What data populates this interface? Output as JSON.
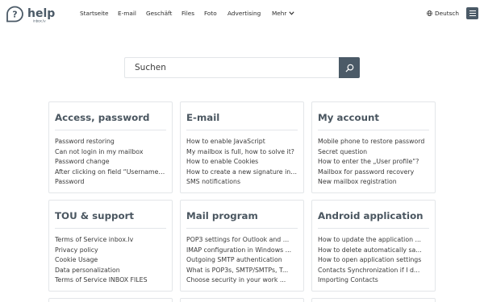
{
  "header": {
    "nav": [
      "Startseite",
      "E-mail",
      "Geschäft",
      "Files",
      "Foto",
      "Advertising",
      "Mehr"
    ],
    "language": "Deutsch"
  },
  "search": {
    "placeholder": "Suchen"
  },
  "cards": [
    {
      "title": "Access, password",
      "links": [
        "Password restoring",
        "Can not login in my mailbox",
        "Password change",
        "After clicking on field “Username” ...",
        "Password"
      ]
    },
    {
      "title": "E-mail",
      "links": [
        "How to enable JavaScript",
        "My mailbox is full, how to solve it?",
        "How to enable Cookies",
        "How to create a new signature in my ...",
        "SMS notifications"
      ]
    },
    {
      "title": "My account",
      "links": [
        "Mobile phone to restore password",
        "Secret question",
        "How to enter the „User profile”?",
        "Mailbox for password recovery",
        "New mailbox registration"
      ]
    },
    {
      "title": "TOU & support",
      "links": [
        "Terms of Service inbox.lv",
        "Privacy policy",
        "Cookie Usage",
        "Data personalization",
        "Terms of Service INBOX FILES"
      ]
    },
    {
      "title": "Mail program",
      "links": [
        "POP3 settings for Outlook and ...",
        "IMAP configuration in Windows ...",
        "Outgoing SMTP authentication",
        "What is POP3s, SMTP/SMTPs, T...",
        "Choose security in your work ..."
      ]
    },
    {
      "title": "Android application",
      "links": [
        "How to update the application ...",
        "How to delete automatically sa...",
        "How to open application settings",
        "Contacts Synchronization if I d...",
        "Importing Contacts"
      ]
    }
  ]
}
